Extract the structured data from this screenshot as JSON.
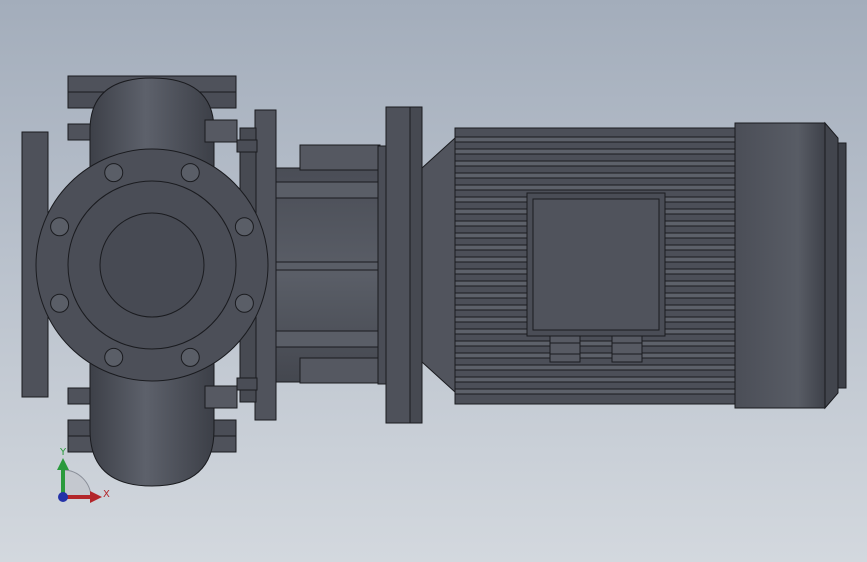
{
  "viewport": {
    "background_top": "#a3adbb",
    "background_bottom": "#d3d8de"
  },
  "model": {
    "part_color": "#4c4f58",
    "edge_color": "#1a1b1f",
    "highlight_color": "#6a6e78"
  },
  "triad": {
    "x_label": "X",
    "y_label": "Y",
    "x_color": "#b3262a",
    "y_color": "#2a9a3c",
    "z_color": "#2433a8"
  }
}
